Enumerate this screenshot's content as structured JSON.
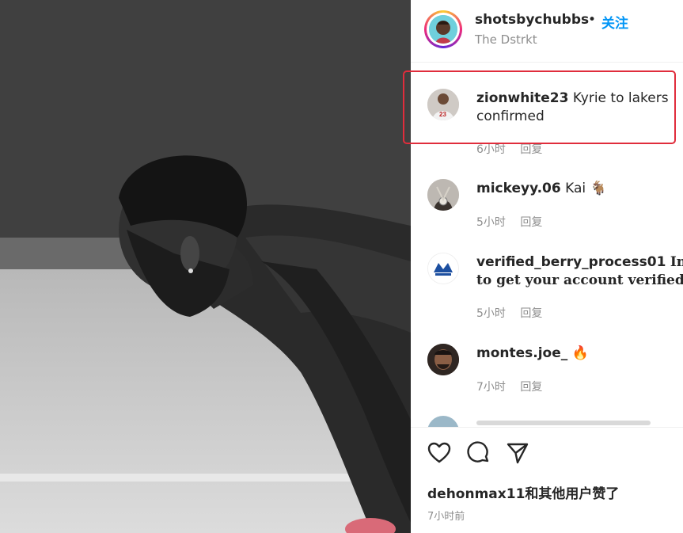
{
  "post": {
    "username": "shotsbychubbs",
    "separator": "•",
    "follow_label": "关注",
    "location": "The Dstrkt"
  },
  "comments": [
    {
      "username": "zionwhite23",
      "text": "Kyrie to lakers",
      "text_line2": "confirmed",
      "time": "6小时",
      "reply_label": "回复",
      "avatar_icon": "jersey-avatar"
    },
    {
      "username": "mickeyy.06",
      "text": "Kai 🐐",
      "time": "5小时",
      "reply_label": "回复",
      "avatar_icon": "chain-avatar"
    },
    {
      "username": "verified_berry_process01",
      "text": "Inbo",
      "text_line2": "to get your account verified🔵💯",
      "time": "5小时",
      "reply_label": "回复",
      "avatar_icon": "badge-logo-avatar"
    },
    {
      "username": "montes.joe_",
      "text": "🔥",
      "time": "7小时",
      "reply_label": "回复",
      "avatar_icon": "person-avatar"
    }
  ],
  "actions": {
    "like_icon": "heart-icon",
    "comment_icon": "comment-icon",
    "share_icon": "send-icon"
  },
  "likes_text": "dehonmax11和其他用户赞了",
  "timestamp": "7小时前",
  "colors": {
    "follow": "#0095f6",
    "highlight": "#e02d3c",
    "muted": "#8e8e8e"
  }
}
